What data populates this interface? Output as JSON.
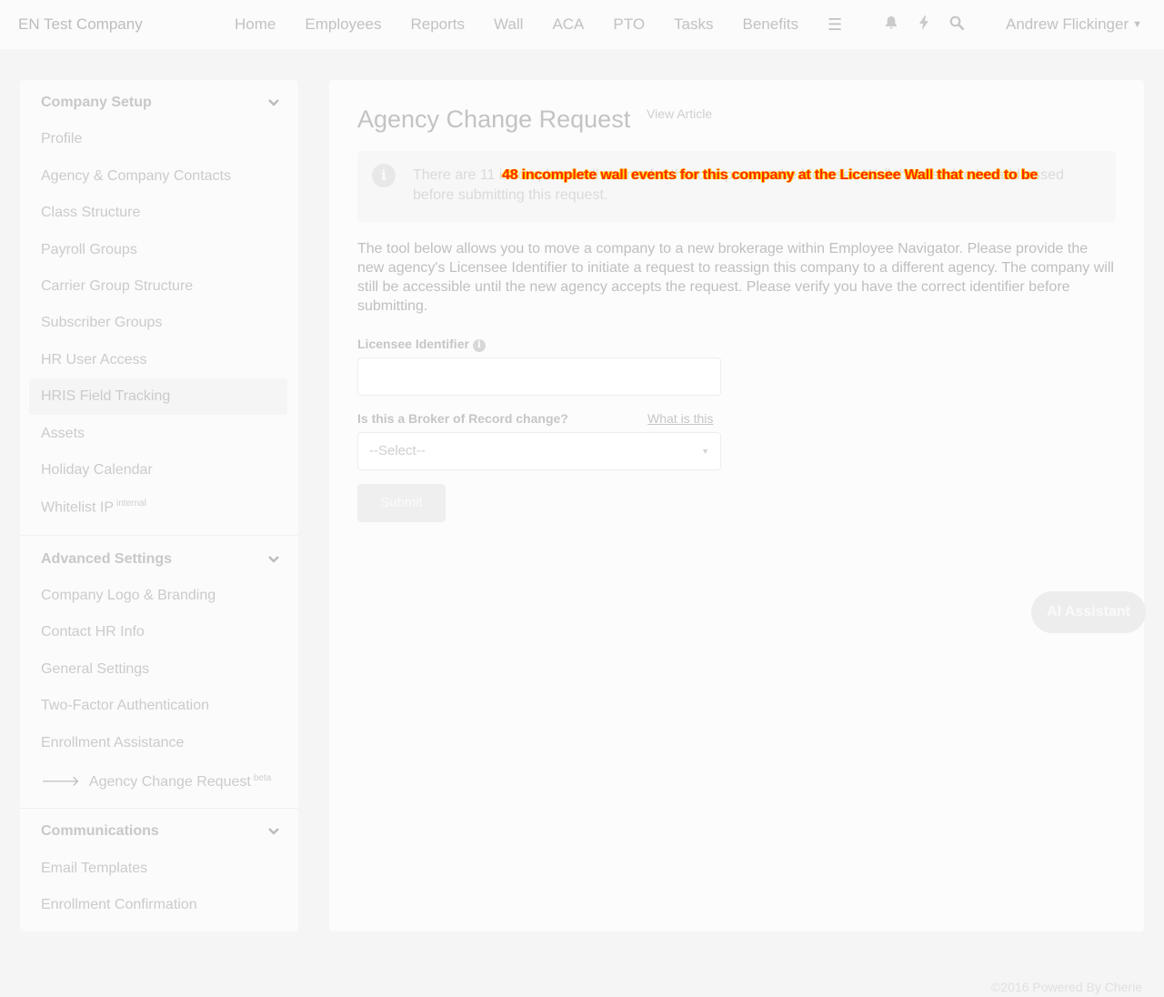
{
  "header": {
    "brand": "EN Test Company",
    "nav": [
      "Home",
      "Employees",
      "Reports",
      "Wall",
      "ACA",
      "PTO",
      "Tasks",
      "Benefits"
    ],
    "menu_icon": "hamburger-icon",
    "icons": [
      "bell-icon",
      "bolt-icon",
      "search-icon"
    ],
    "user": "Andrew Flickinger"
  },
  "sidebar": {
    "sections": [
      {
        "title": "Company Setup",
        "items": [
          {
            "label": "Profile"
          },
          {
            "label": "Agency & Company Contacts"
          },
          {
            "label": "Class Structure"
          },
          {
            "label": "Payroll Groups"
          },
          {
            "label": "Carrier Group Structure"
          },
          {
            "label": "Subscriber Groups"
          },
          {
            "label": "HR User Access"
          },
          {
            "label": "HRIS Field Tracking"
          },
          {
            "label": "Assets"
          },
          {
            "label": "Holiday Calendar"
          },
          {
            "label": "Whitelist IP",
            "badge": "internal"
          }
        ]
      },
      {
        "title": "Advanced Settings",
        "items": [
          {
            "label": "Company Logo & Branding"
          },
          {
            "label": "Contact HR Info"
          },
          {
            "label": "General Settings"
          },
          {
            "label": "Two-Factor Authentication"
          },
          {
            "label": "Enrollment Assistance"
          },
          {
            "label": "Agency Change Request",
            "badge": "beta",
            "active": true
          }
        ]
      },
      {
        "title": "Communications",
        "items": [
          {
            "label": "Email Templates"
          },
          {
            "label": "Enrollment Confirmation"
          }
        ]
      }
    ]
  },
  "main": {
    "title": "Agency Change Request",
    "view_article": "View Article",
    "alert_text": "There are 11 incomplete wall events for this company at the Licensee Wall that need to be addressed before submitting this request.",
    "overlay_text": "48 incomplete wall events for this company at the Licensee Wall that need to be",
    "description": "The tool below allows you to move a company to a new brokerage within Employee Navigator. Please provide the new agency's Licensee Identifier to initiate a request to reassign this company to a different agency. The company will still be accessible until the new agency accepts the request. Please verify you have the correct identifier before submitting.",
    "licensee_label": "Licensee Identifier",
    "licensee_value": "",
    "bor_label": "Is this a Broker of Record change?",
    "what_is_this": "What is this",
    "select_value": "--Select--",
    "submit_label": "Submit"
  },
  "ai_assistant": "AI Assistant",
  "footer": "©2016 Powered By Cherie"
}
